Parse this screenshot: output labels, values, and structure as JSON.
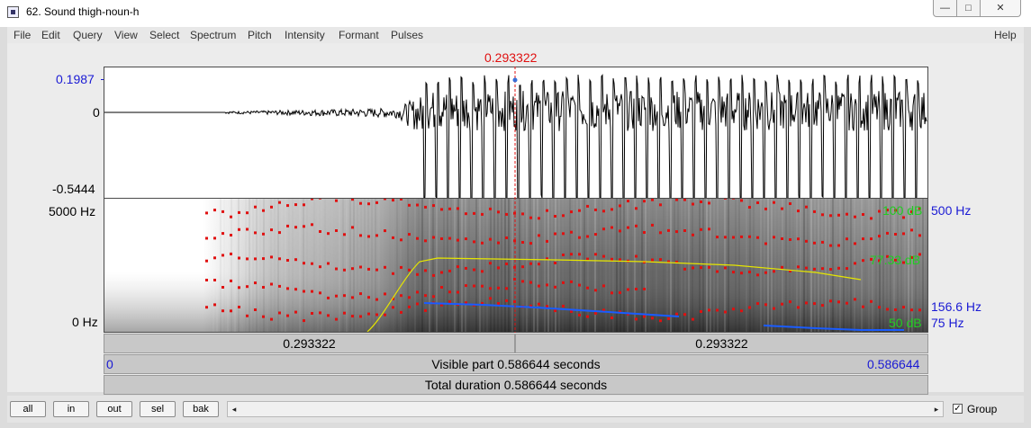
{
  "window": {
    "title": "62. Sound thigh-noun-h",
    "controls": {
      "minimize": "—",
      "maximize": "□",
      "close": "✕"
    }
  },
  "menu": [
    "File",
    "Edit",
    "Query",
    "View",
    "Select",
    "Spectrum",
    "Pitch",
    "Intensity",
    "Formant",
    "Pulses"
  ],
  "help": "Help",
  "cursor": {
    "time_label": "0.293322",
    "time_fraction": 0.5
  },
  "waveform": {
    "ymax": "0.1987",
    "yzero": "0",
    "ymin": "-0.5444"
  },
  "spectrogram": {
    "ytop": "5000 Hz",
    "ybottom": "0 Hz",
    "intensity_top": "100 dB",
    "intensity_mid": "77.33 dB",
    "intensity_bottom": "50 dB",
    "pitch_top": "500 Hz",
    "pitch_mid": "156.6 Hz",
    "pitch_bottom": "75 Hz"
  },
  "time_bars": {
    "left_segment": "0.293322",
    "right_segment": "0.293322",
    "visible_start": "0",
    "visible_label": "Visible part 0.586644 seconds",
    "visible_end": "0.586644",
    "total_label": "Total duration 0.586644 seconds"
  },
  "toolbar": {
    "buttons": [
      "all",
      "in",
      "out",
      "sel",
      "bak"
    ],
    "scroll_left": "◂",
    "scroll_right": "▸",
    "group_checked": "✓",
    "group_label": "Group"
  },
  "colors": {
    "cursor": "#e01010",
    "axis_blue": "#1a1ad4",
    "intensity": "#22cc22",
    "formant": "#e01010",
    "pitch": "#1a5cff",
    "intensity_curve": "#e6e600"
  }
}
